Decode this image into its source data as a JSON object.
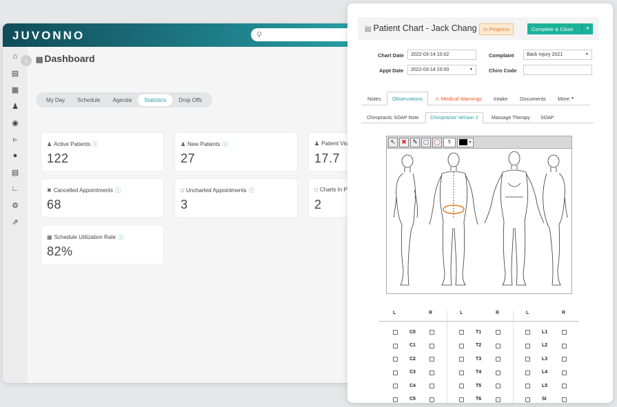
{
  "dashboard": {
    "logo": "JUVONNO",
    "title": "Dashboard",
    "tabs": [
      {
        "label": "My Day"
      },
      {
        "label": "Schedule"
      },
      {
        "label": "Agenda"
      },
      {
        "label": "Statistics"
      },
      {
        "label": "Drop Offs"
      }
    ],
    "active_tab": "Statistics",
    "cards": [
      {
        "label": "Active Patients",
        "value": "122"
      },
      {
        "label": "New Patients",
        "value": "27"
      },
      {
        "label": "Patient Vis",
        "value": "17.7"
      },
      {
        "label": "Cancelled Appointments",
        "value": "68"
      },
      {
        "label": "Uncharted Appointments",
        "value": "3"
      },
      {
        "label": "Charts In P",
        "value": "2"
      },
      {
        "label": "Schedule Utilization Rate",
        "value": "82%"
      }
    ],
    "sidebar_icons": [
      "home-icon",
      "monitor-icon",
      "clipboard-icon",
      "users-icon",
      "dollar-icon",
      "megaphone-icon",
      "chat-icon",
      "document-icon",
      "chart-icon",
      "gear-icon",
      "export-icon"
    ]
  },
  "chart": {
    "title": "Patient Chart - Jack Chang",
    "status": "In Progress",
    "complete_label": "Complete & Close",
    "fields": {
      "chart_date_label": "Chart Date",
      "chart_date_value": "2022-03-14 10:02",
      "appt_date_label": "Appt Date",
      "appt_date_value": "2022-03-14 10:00",
      "complaint_label": "Complaint",
      "complaint_value": "Back Injury 2021",
      "chiro_code_label": "Chiro Code",
      "chiro_code_value": ""
    },
    "tabs": [
      {
        "label": "Notes"
      },
      {
        "label": "Observations"
      },
      {
        "label": "Medical Warnings"
      },
      {
        "label": "Intake"
      },
      {
        "label": "Documents"
      },
      {
        "label": "More"
      }
    ],
    "subtabs": [
      {
        "label": "Chiropractic SOAP Note"
      },
      {
        "label": "Chiropractor Version 2"
      },
      {
        "label": "Massage Therapy"
      },
      {
        "label": "SOAP"
      }
    ],
    "brush_size": "5",
    "spine": {
      "headers": [
        "L",
        "R"
      ],
      "columns": [
        [
          "C0",
          "C1",
          "C2",
          "C3",
          "C4",
          "C5"
        ],
        [
          "T1",
          "T2",
          "T3",
          "T4",
          "T5",
          "T6"
        ],
        [
          "L1",
          "L2",
          "L3",
          "L4",
          "L5",
          "SI"
        ]
      ]
    }
  }
}
